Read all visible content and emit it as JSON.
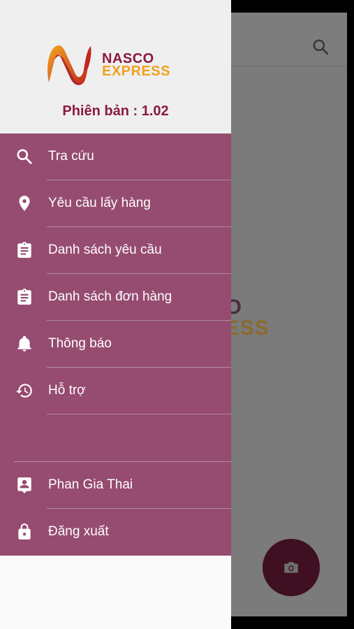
{
  "background_app": {
    "logo_line1": "CO",
    "logo_line2": "RESS"
  },
  "drawer": {
    "logo_line1": "NASCO",
    "logo_line2": "EXPRESS",
    "version_label": "Phiên bản : 1.02",
    "menu": [
      {
        "label": "Tra cứu",
        "icon": "search-icon"
      },
      {
        "label": "Yêu cầu lấy hàng",
        "icon": "location-pin-icon"
      },
      {
        "label": "Danh sách yêu cầu",
        "icon": "clipboard-icon"
      },
      {
        "label": "Danh sách đơn hàng",
        "icon": "clipboard-icon"
      },
      {
        "label": "Thông báo",
        "icon": "bell-icon"
      },
      {
        "label": "Hỗ trợ",
        "icon": "history-icon"
      }
    ],
    "account": [
      {
        "label": "Phan Gia Thai",
        "icon": "contact-icon"
      },
      {
        "label": "Đăng xuất",
        "icon": "lock-icon"
      }
    ]
  },
  "colors": {
    "menu_bg": "#964b70",
    "brand_red": "#8b1a3f",
    "brand_orange": "#f0a21e",
    "fab": "#3f0f22"
  }
}
